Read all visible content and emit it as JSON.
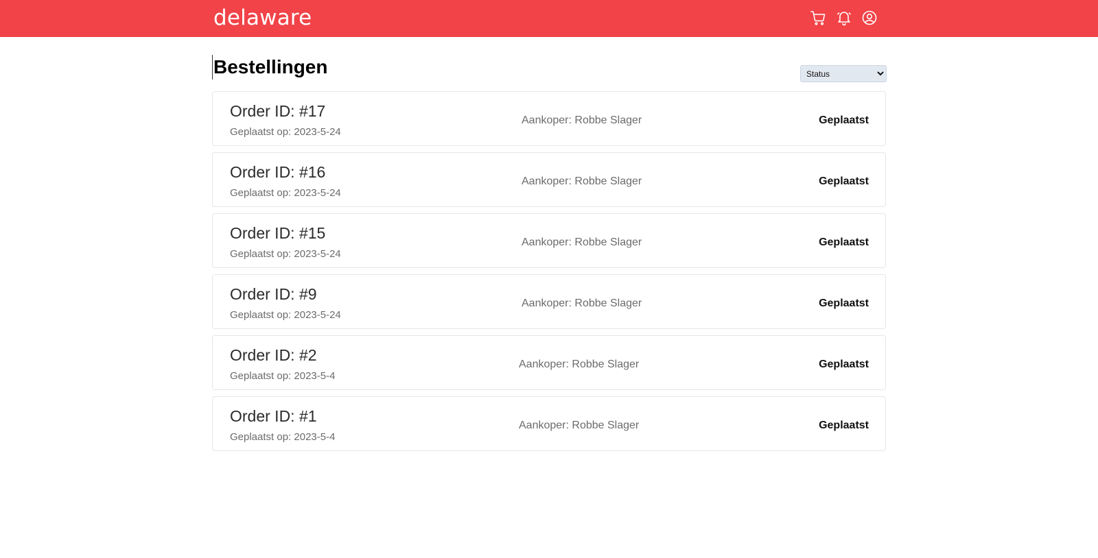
{
  "header": {
    "logo": "delaware",
    "brand_color": "#f14348",
    "icons": [
      "cart-icon",
      "bell-icon",
      "user-icon"
    ]
  },
  "page": {
    "title": "Bestellingen"
  },
  "filter": {
    "selected": "Status",
    "options": [
      "Status"
    ]
  },
  "orders": [
    {
      "id": "Order ID: #17",
      "date": "Geplaatst op: 2023-5-24",
      "buyer": "Aankoper: Robbe Slager",
      "status": "Geplaatst"
    },
    {
      "id": "Order ID: #16",
      "date": "Geplaatst op: 2023-5-24",
      "buyer": "Aankoper: Robbe Slager",
      "status": "Geplaatst"
    },
    {
      "id": "Order ID: #15",
      "date": "Geplaatst op: 2023-5-24",
      "buyer": "Aankoper: Robbe Slager",
      "status": "Geplaatst"
    },
    {
      "id": "Order ID: #9",
      "date": "Geplaatst op: 2023-5-24",
      "buyer": "Aankoper: Robbe Slager",
      "status": "Geplaatst"
    },
    {
      "id": "Order ID: #2",
      "date": "Geplaatst op: 2023-5-4",
      "buyer": "Aankoper: Robbe Slager",
      "status": "Geplaatst"
    },
    {
      "id": "Order ID: #1",
      "date": "Geplaatst op: 2023-5-4",
      "buyer": "Aankoper: Robbe Slager",
      "status": "Geplaatst"
    }
  ]
}
